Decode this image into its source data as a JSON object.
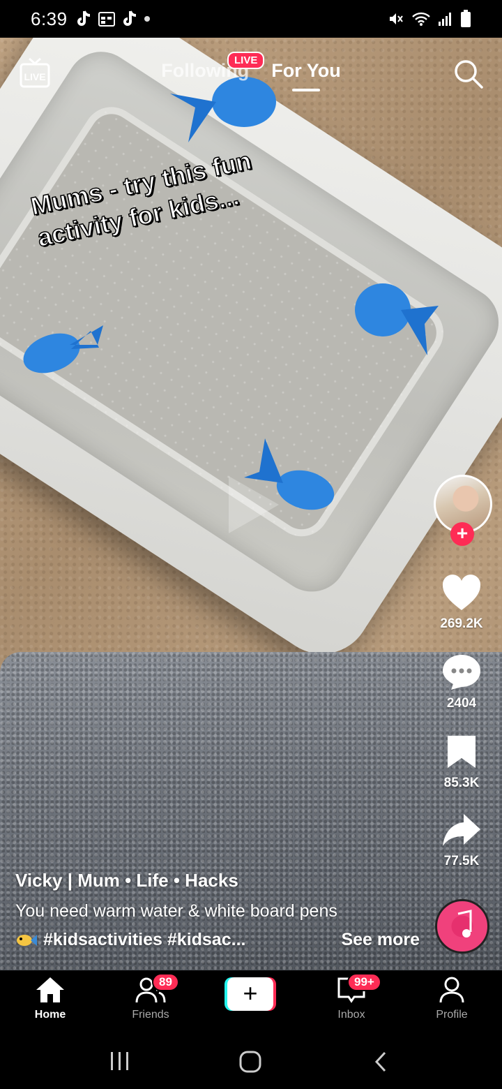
{
  "status_bar": {
    "time": "6:39"
  },
  "video": {
    "overlay_text": "Mums - try this fun\nactivity for kids..."
  },
  "top_nav": {
    "following_label": "Following",
    "foryou_label": "For You",
    "live_badge": "LIVE",
    "live_icon_label": "LIVE"
  },
  "rail": {
    "likes": "269.2K",
    "comments": "2404",
    "saves": "85.3K",
    "shares": "77.5K"
  },
  "caption": {
    "author": "Vicky | Mum • Life • Hacks",
    "description": "You need warm water & white board pens",
    "tags": "#kidsactivities #kidsac...",
    "see_more": "See more"
  },
  "bottom_nav": {
    "home": "Home",
    "friends": "Friends",
    "friends_badge": "89",
    "inbox": "Inbox",
    "inbox_badge": "99+",
    "profile": "Profile",
    "create": "+"
  },
  "colors": {
    "accent": "#fe2c55",
    "cyan": "#25f4ee"
  }
}
